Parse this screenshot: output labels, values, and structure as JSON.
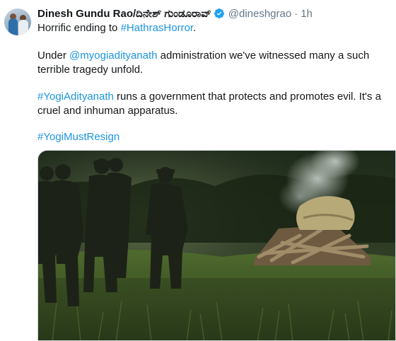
{
  "tweet": {
    "author": {
      "name": "Dinesh Gundu Rao/ದಿನೇಶ್ ಗುಂಡೂರಾವ್",
      "handle": "@dineshgrao",
      "separator": "·",
      "time": "1h",
      "verified_icon": "verified-badge-icon",
      "verified_color": "#1da1f2"
    },
    "lines": {
      "l1_text": "Horrific ending to ",
      "l1_link": "#HathrasHorror",
      "l1_end": ".",
      "l2_text": "Under ",
      "l2_link": "@myogiadityanath",
      "l2_end": " administration we've witnessed many a such",
      "l3": "terrible tragedy unfold.",
      "l4_link": "#YogiAdityanath",
      "l4_end": " runs a government that protects and promotes evil. It's a",
      "l5": "cruel and inhuman apparatus.",
      "l6_link": "#YogiMustResign"
    },
    "link_color": "#1b95e0"
  }
}
